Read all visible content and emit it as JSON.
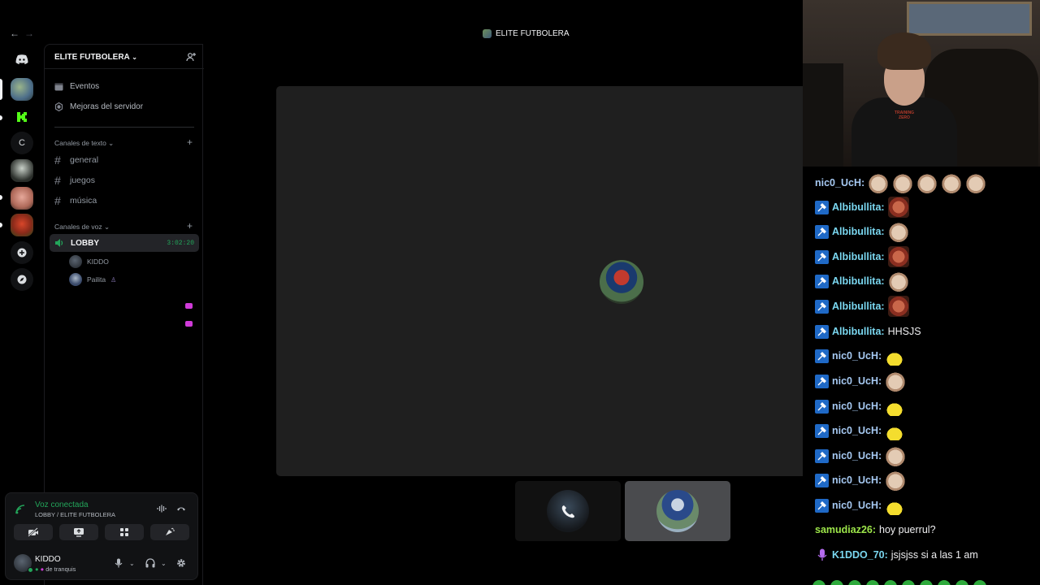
{
  "window": {
    "title": "ELITE FUTBOLERA"
  },
  "nav": {
    "back": "←",
    "forward": "→"
  },
  "guilds": [
    {
      "name": "discord-home",
      "label": ""
    },
    {
      "name": "server-elite-futbolera",
      "label": ""
    },
    {
      "name": "server-kick",
      "label": ""
    },
    {
      "name": "server-c",
      "label": "C"
    },
    {
      "name": "server-4",
      "label": ""
    },
    {
      "name": "server-5",
      "label": ""
    },
    {
      "name": "server-6",
      "label": ""
    },
    {
      "name": "add-server",
      "label": "+"
    },
    {
      "name": "discover",
      "label": ""
    }
  ],
  "sidebar": {
    "server_name": "ELITE FUTBOLERA",
    "events": "Eventos",
    "boosts": "Mejoras del servidor",
    "text_category": "Canales de texto",
    "text_channels": [
      "general",
      "juegos",
      "música"
    ],
    "voice_category": "Canales de voz",
    "voice_channel": {
      "name": "LOBBY",
      "timer": "3:02:20"
    },
    "voice_users": [
      {
        "name": "KIDDO"
      },
      {
        "name": "Pailita"
      }
    ]
  },
  "voice_panel": {
    "status": "Voz conectada",
    "location": "LOBBY / ELITE FUTBOLERA"
  },
  "user": {
    "name": "KIDDO",
    "status": "de tranquis"
  },
  "chat": {
    "lines": [
      {
        "user": "nic0_UcH",
        "color": "#a6c9f2",
        "badge": false,
        "text": "",
        "emotes": [
          "cat",
          "cat",
          "cat",
          "cat",
          "cat"
        ]
      },
      {
        "user": "Albibullita",
        "color": "#7ad7f0",
        "badge": true,
        "text": "",
        "emotes": [
          "face"
        ]
      },
      {
        "user": "Albibullita",
        "color": "#7ad7f0",
        "badge": true,
        "text": "",
        "emotes": [
          "cat"
        ]
      },
      {
        "user": "Albibullita",
        "color": "#7ad7f0",
        "badge": true,
        "text": "",
        "emotes": [
          "face"
        ]
      },
      {
        "user": "Albibullita",
        "color": "#7ad7f0",
        "badge": true,
        "text": "",
        "emotes": [
          "cat"
        ]
      },
      {
        "user": "Albibullita",
        "color": "#7ad7f0",
        "badge": true,
        "text": "",
        "emotes": [
          "face"
        ]
      },
      {
        "user": "Albibullita",
        "color": "#7ad7f0",
        "badge": true,
        "text": "HHSJS",
        "emotes": []
      },
      {
        "user": "nic0_UcH",
        "color": "#a6c9f2",
        "badge": true,
        "text": "",
        "emotes": [
          "duck"
        ]
      },
      {
        "user": "nic0_UcH",
        "color": "#a6c9f2",
        "badge": true,
        "text": "",
        "emotes": [
          "cat"
        ]
      },
      {
        "user": "nic0_UcH",
        "color": "#a6c9f2",
        "badge": true,
        "text": "",
        "emotes": [
          "duck"
        ]
      },
      {
        "user": "nic0_UcH",
        "color": "#a6c9f2",
        "badge": true,
        "text": "",
        "emotes": [
          "duck"
        ]
      },
      {
        "user": "nic0_UcH",
        "color": "#a6c9f2",
        "badge": true,
        "text": "",
        "emotes": [
          "cat"
        ]
      },
      {
        "user": "nic0_UcH",
        "color": "#a6c9f2",
        "badge": true,
        "text": "",
        "emotes": [
          "cat"
        ]
      },
      {
        "user": "nic0_UcH",
        "color": "#a6c9f2",
        "badge": true,
        "text": "",
        "emotes": [
          "duck"
        ]
      },
      {
        "user": "samudiaz26",
        "color": "#9de64a",
        "badge": false,
        "text": "hoy puerrul?",
        "emotes": []
      },
      {
        "user": "K1DDO_70",
        "color": "#7ad7f0",
        "badge": "mic",
        "text": "jsjsjss si a las 1 am",
        "emotes": []
      }
    ]
  },
  "colors": {
    "accent_green": "#23a55a",
    "badge_blue": "#1f69c6",
    "mic_purple": "#b56cf0"
  }
}
